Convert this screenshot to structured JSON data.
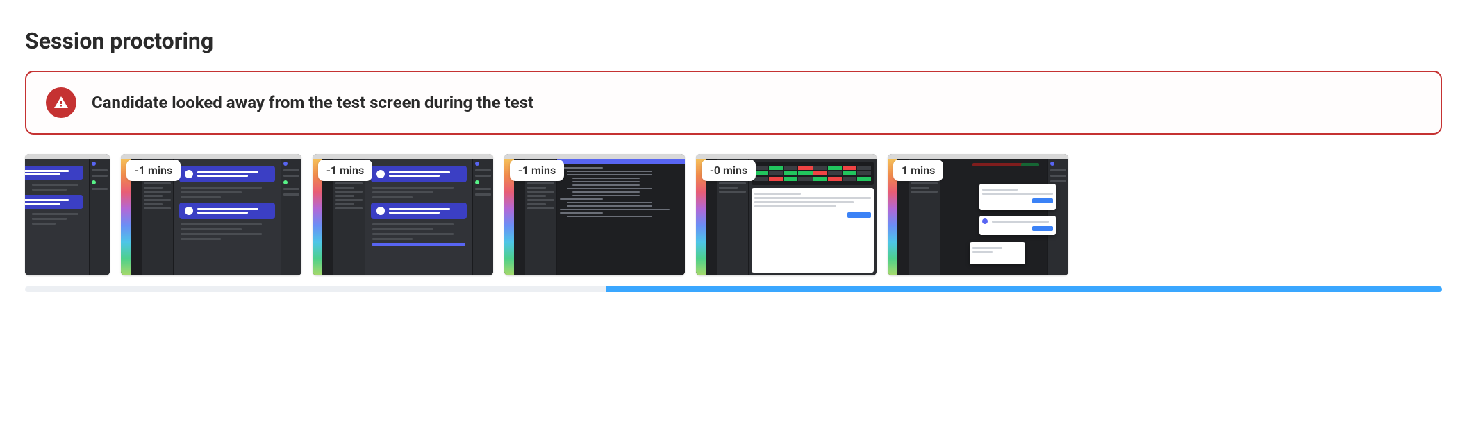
{
  "section": {
    "title": "Session proctoring"
  },
  "alert": {
    "icon": "alert-triangle-icon",
    "message": "Candidate looked away from the test screen during the test",
    "color": "#c53232"
  },
  "thumbnails": [
    {
      "time_label": "",
      "kind": "discord-cards-partial"
    },
    {
      "time_label": "-1 mins",
      "kind": "discord-cards"
    },
    {
      "time_label": "-1 mins",
      "kind": "discord-cards"
    },
    {
      "time_label": "-1 mins",
      "kind": "code-editor"
    },
    {
      "time_label": "-0 mins",
      "kind": "trace-panel"
    },
    {
      "time_label": "1 mins",
      "kind": "modal-stack"
    }
  ],
  "timeline": {
    "start_pct": 41,
    "end_pct": 100
  }
}
